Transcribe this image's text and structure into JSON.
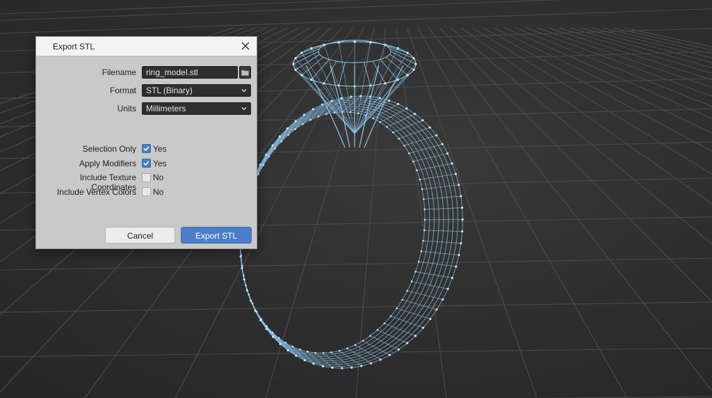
{
  "dialog": {
    "title": "Export STL",
    "filename_label": "Filename",
    "filename_value": "ring_model.stl",
    "format_label": "Format",
    "format_value": "STL (Binary)",
    "units_label": "Units",
    "units_value": "Millimeters",
    "options": [
      {
        "label": "Selection Only",
        "checked": true,
        "state_text": "Yes"
      },
      {
        "label": "Apply Modifiers",
        "checked": true,
        "state_text": "Yes"
      },
      {
        "label": "Include Texture Coordinates",
        "checked": false,
        "state_text": "No"
      },
      {
        "label": "Include Vertex Colors",
        "checked": false,
        "state_text": "No"
      }
    ],
    "cancel_label": "Cancel",
    "export_label": "Export STL"
  },
  "colors": {
    "accent": "#4a7fc8",
    "wireframe": "#8fc8ee",
    "grid": "#4a4a4a"
  },
  "icons": {
    "close": "close-icon",
    "folder": "folder-icon",
    "chevron": "chevron-down-icon",
    "check": "check-icon"
  }
}
